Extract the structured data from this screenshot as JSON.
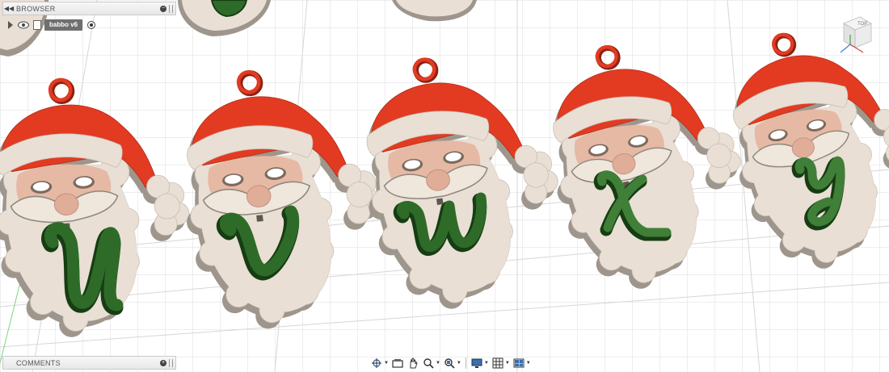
{
  "browser": {
    "title": "BROWSER",
    "component_name": "babbo v6"
  },
  "comments": {
    "title": "COMMENTS"
  },
  "viewcube": {
    "face_label": "TOP"
  },
  "ornaments": [
    {
      "letter": "U"
    },
    {
      "letter": "V"
    },
    {
      "letter": "W"
    },
    {
      "letter": "X"
    },
    {
      "letter": "Y"
    }
  ],
  "nav_toolbar": [
    {
      "icon": "orbit-icon"
    },
    {
      "icon": "look-at-icon"
    },
    {
      "icon": "pan-icon"
    },
    {
      "icon": "zoom-icon"
    },
    {
      "icon": "fit-icon"
    },
    {
      "icon": "display-settings-icon"
    },
    {
      "icon": "grid-snaps-icon"
    },
    {
      "icon": "viewports-icon"
    }
  ],
  "colors": {
    "body": "#e9dfd4",
    "body_side": "#9e968c",
    "hat": "#e23b22",
    "hat_side": "#8c2212",
    "face": "#e6b9a4",
    "letter": "#2e6b28",
    "letter_side": "#163d13"
  }
}
